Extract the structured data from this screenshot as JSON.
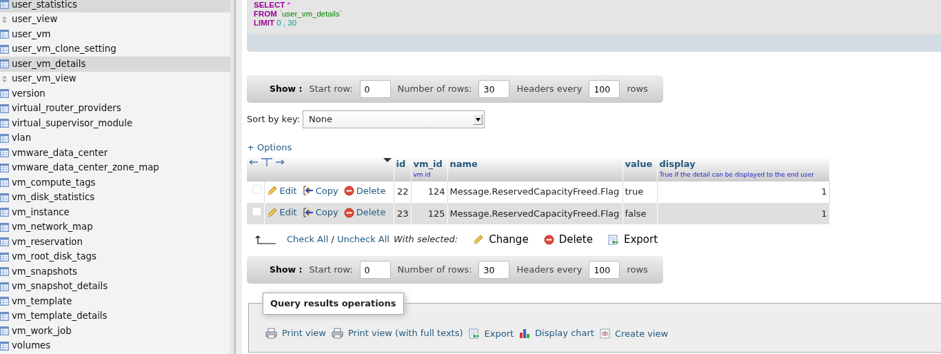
{
  "sidebar": {
    "items": [
      {
        "label": "user_statistics",
        "kind": "table",
        "selected": true
      },
      {
        "label": "user_view",
        "kind": "view",
        "selected": false
      },
      {
        "label": "user_vm",
        "kind": "table",
        "selected": false
      },
      {
        "label": "user_vm_clone_setting",
        "kind": "table",
        "selected": false
      },
      {
        "label": "user_vm_details",
        "kind": "table",
        "selected": true
      },
      {
        "label": "user_vm_view",
        "kind": "view",
        "selected": false
      },
      {
        "label": "version",
        "kind": "table",
        "selected": false
      },
      {
        "label": "virtual_router_providers",
        "kind": "table",
        "selected": false
      },
      {
        "label": "virtual_supervisor_module",
        "kind": "table",
        "selected": false
      },
      {
        "label": "vlan",
        "kind": "table",
        "selected": false
      },
      {
        "label": "vmware_data_center",
        "kind": "table",
        "selected": false
      },
      {
        "label": "vmware_data_center_zone_map",
        "kind": "table",
        "selected": false
      },
      {
        "label": "vm_compute_tags",
        "kind": "table",
        "selected": false
      },
      {
        "label": "vm_disk_statistics",
        "kind": "table",
        "selected": false
      },
      {
        "label": "vm_instance",
        "kind": "table",
        "selected": false
      },
      {
        "label": "vm_network_map",
        "kind": "table",
        "selected": false
      },
      {
        "label": "vm_reservation",
        "kind": "table",
        "selected": false
      },
      {
        "label": "vm_root_disk_tags",
        "kind": "table",
        "selected": false
      },
      {
        "label": "vm_snapshots",
        "kind": "table",
        "selected": false
      },
      {
        "label": "vm_snapshot_details",
        "kind": "table",
        "selected": false
      },
      {
        "label": "vm_template",
        "kind": "table",
        "selected": false
      },
      {
        "label": "vm_template_details",
        "kind": "table",
        "selected": false
      },
      {
        "label": "vm_work_job",
        "kind": "table",
        "selected": false
      },
      {
        "label": "volumes",
        "kind": "table",
        "selected": false
      }
    ]
  },
  "sql": {
    "lines": [
      [
        {
          "text": "SELECT",
          "kind": "keyword"
        },
        {
          "text": "*",
          "kind": "operator"
        }
      ],
      [
        {
          "text": "FROM",
          "kind": "keyword"
        },
        {
          "text": "`user_vm_details`",
          "kind": "identifier"
        }
      ],
      [
        {
          "text": "LIMIT",
          "kind": "keyword"
        },
        {
          "text": "0",
          "kind": "number"
        },
        {
          "text": ",",
          "kind": "number"
        },
        {
          "text": "30",
          "kind": "number"
        }
      ]
    ]
  },
  "show_bars": [
    {
      "label": "Show :",
      "fields": [
        {
          "label": "Start row:",
          "value": "0"
        },
        {
          "label": "Number of rows:",
          "value": "30"
        },
        {
          "label": "Headers every",
          "value": "100"
        }
      ],
      "suffix": "rows"
    },
    {
      "label": "Show :",
      "fields": [
        {
          "label": "Start row:",
          "value": "0"
        },
        {
          "label": "Number of rows:",
          "value": "30"
        },
        {
          "label": "Headers every",
          "value": "100"
        }
      ],
      "suffix": "rows"
    }
  ],
  "sort_by_key": {
    "label": "Sort by key:",
    "value": "None"
  },
  "options_link": "+ Options",
  "table": {
    "columns": [
      {
        "label": "id"
      },
      {
        "label": "vm_id",
        "sublabel": "vm id"
      },
      {
        "label": "name"
      },
      {
        "label": "value"
      },
      {
        "label": "display",
        "sublabel": "True if the detail can be displayed to the end user"
      }
    ],
    "rows": [
      {
        "checked": false,
        "actions": [
          "Edit",
          "Copy",
          "Delete"
        ],
        "cells": [
          "22",
          "124",
          "Message.ReservedCapacityFreed.Flag",
          "true",
          "1"
        ]
      },
      {
        "checked": false,
        "actions": [
          "Edit",
          "Copy",
          "Delete"
        ],
        "cells": [
          "23",
          "125",
          "Message.ReservedCapacityFreed.Flag",
          "false",
          "1"
        ]
      }
    ]
  },
  "bulk": {
    "check_all": "Check All",
    "separator": "/",
    "uncheck_all": "Uncheck All",
    "with_selected": "With selected:",
    "actions": [
      {
        "label": "Change",
        "kind": "edit"
      },
      {
        "label": "Delete",
        "kind": "delete"
      },
      {
        "label": "Export",
        "kind": "export"
      }
    ]
  },
  "operations": {
    "title": "Query results operations",
    "links": [
      {
        "label": "Print view",
        "kind": "print"
      },
      {
        "label": "Print view (with full texts)",
        "kind": "print"
      },
      {
        "label": "Export",
        "kind": "export"
      },
      {
        "label": "Display chart",
        "kind": "chart"
      },
      {
        "label": "Create view",
        "kind": "view"
      }
    ]
  }
}
